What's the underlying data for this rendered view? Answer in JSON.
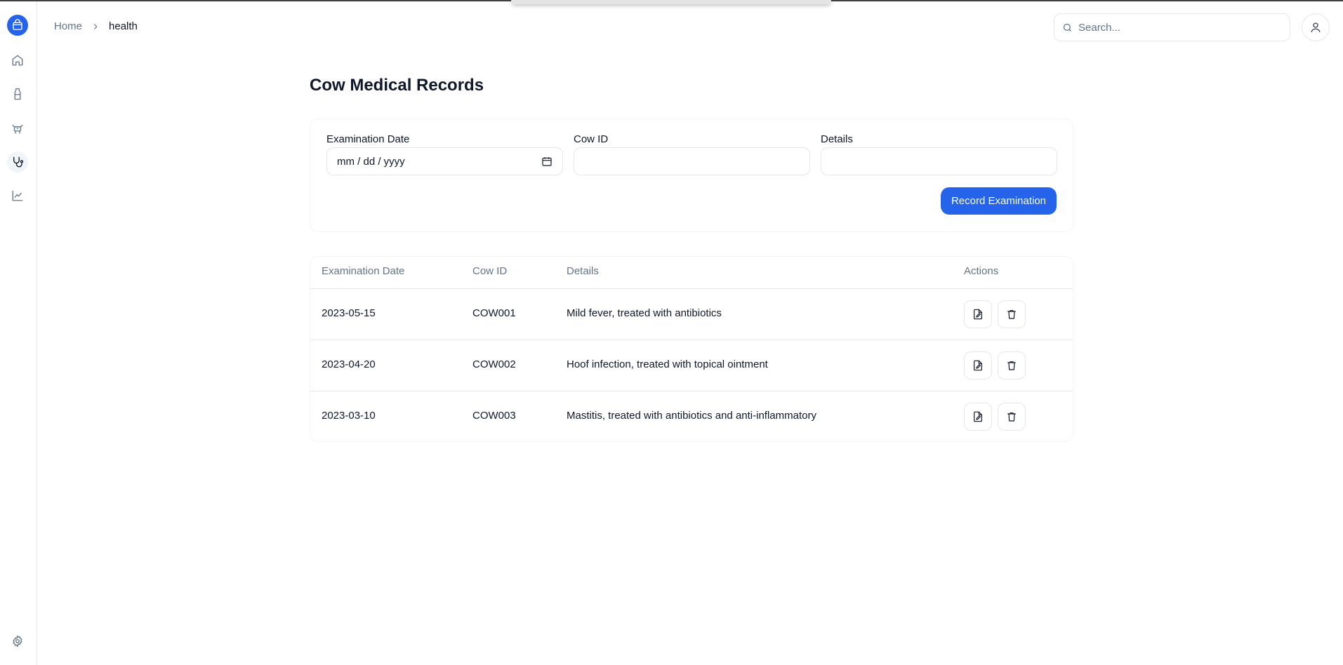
{
  "header": {
    "breadcrumb": {
      "home": "Home",
      "current": "health"
    },
    "search": {
      "placeholder": "Search..."
    }
  },
  "sidebar": {
    "items": [
      {
        "icon": "logo-bag-icon"
      },
      {
        "icon": "home-icon"
      },
      {
        "icon": "milk-bottle-icon"
      },
      {
        "icon": "cow-icon"
      },
      {
        "icon": "stethoscope-icon",
        "active": true
      },
      {
        "icon": "chart-line-icon"
      },
      {
        "icon": "settings-gear-icon"
      }
    ]
  },
  "page": {
    "title": "Cow Medical Records"
  },
  "form": {
    "date_label": "Examination Date",
    "date_placeholder": "mm / dd / yyyy",
    "cow_id_label": "Cow ID",
    "cow_id_value": "",
    "details_label": "Details",
    "details_value": "",
    "submit_label": "Record Examination"
  },
  "table": {
    "columns": [
      "Examination Date",
      "Cow ID",
      "Details",
      "Actions"
    ],
    "rows": [
      {
        "date": "2023-05-15",
        "cow_id": "COW001",
        "details": "Mild fever, treated with antibiotics"
      },
      {
        "date": "2023-04-20",
        "cow_id": "COW002",
        "details": "Hoof infection, treated with topical ointment"
      },
      {
        "date": "2023-03-10",
        "cow_id": "COW003",
        "details": "Mastitis, treated with antibiotics and anti-inflammatory"
      }
    ]
  },
  "colors": {
    "accent": "#2563eb",
    "muted": "#64748b",
    "border": "#e5e7eb"
  }
}
